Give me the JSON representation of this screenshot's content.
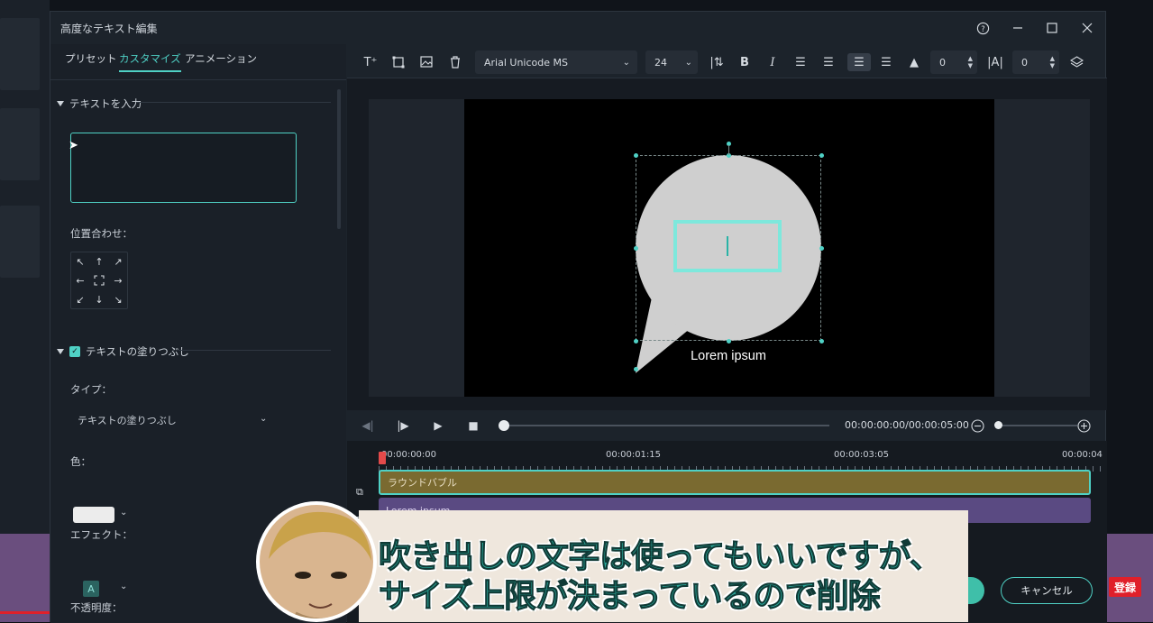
{
  "window": {
    "title": "高度なテキスト編集"
  },
  "tabs": [
    {
      "label": "プリセット"
    },
    {
      "label": "カスタマイズ"
    },
    {
      "label": "アニメーション"
    }
  ],
  "left": {
    "input_section": "テキストを入力",
    "input_value": "",
    "align_label": "位置合わせ：",
    "fill_section": "テキストの塗りつぶし",
    "type_label": "タイプ：",
    "type_value": "テキストの塗りつぶし",
    "color_label": "色：",
    "color_value": "#ececec",
    "effect_label": "エフェクト：",
    "effect_glyph": "A",
    "opacity_label": "不透明度："
  },
  "toolbar": {
    "font": "Arial Unicode MS",
    "size": "24",
    "spacing1": "0",
    "spacing2": "0"
  },
  "preview": {
    "caption": "Lorem ipsum"
  },
  "player": {
    "timecode": "00:00:00:00/00:00:05:00"
  },
  "timeline": {
    "ticks": [
      "00:00:00:00",
      "00:00:01:15",
      "00:00:03:05",
      "00:00:04"
    ],
    "tracks": [
      {
        "label": "ラウンドバブル"
      },
      {
        "label": "Lorem ipsum"
      }
    ]
  },
  "buttons": {
    "cancel": "キャンセル"
  },
  "overlay": {
    "line1": "吹き出しの文字は使ってもいいですが、",
    "line2": "サイズ上限が決まっているので削除",
    "badge": "登録"
  },
  "colors": {
    "accent": "#4fd1c5",
    "bubble": "#cfcfcf"
  }
}
